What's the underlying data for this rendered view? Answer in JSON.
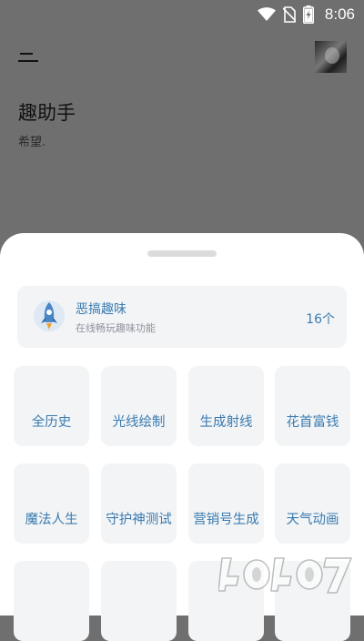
{
  "status_bar": {
    "time": "8:06",
    "icons": [
      "wifi-icon",
      "no-sim-icon",
      "battery-charging-icon"
    ]
  },
  "header": {
    "menu_icon": "menu-icon",
    "avatar": "user-avatar"
  },
  "app": {
    "title": "趣助手",
    "subtitle": "希望."
  },
  "category_card": {
    "icon": "rocket-icon",
    "title": "恶搞趣味",
    "subtitle": "在线畅玩趣味功能",
    "count": "16个"
  },
  "tools": [
    {
      "label": "全历史"
    },
    {
      "label": "光线绘制"
    },
    {
      "label": "生成射线"
    },
    {
      "label": "花首富钱"
    },
    {
      "label": "魔法人生"
    },
    {
      "label": "守护神测试"
    },
    {
      "label": "营销号生成"
    },
    {
      "label": "天气动画"
    },
    {
      "label": ""
    },
    {
      "label": ""
    },
    {
      "label": ""
    },
    {
      "label": ""
    }
  ],
  "watermark": {
    "text": "4o4o7.com"
  },
  "colors": {
    "accent": "#3b7bb0",
    "tile_bg": "#f2f4f6",
    "overlay_bg": "#6f6f6f",
    "sheet_bg": "#ffffff"
  }
}
